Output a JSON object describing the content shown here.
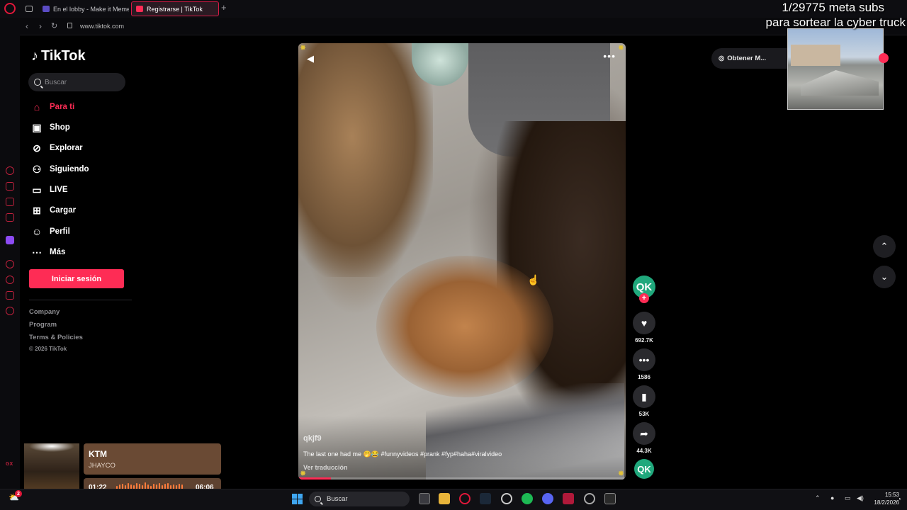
{
  "browser": {
    "tabs": [
      {
        "label": "",
        "icon": "workspaces-icon"
      },
      {
        "label": "En el lobby - Make it Meme",
        "icon": "mim-favicon"
      },
      {
        "label": "Registrarse | TikTok",
        "icon": "tiktok-favicon",
        "active": true
      }
    ],
    "url": "www.tiktok.com"
  },
  "overlay": {
    "line1": "1/29775 meta subs",
    "line2": "para sortear la cyber truck"
  },
  "tiktok": {
    "logo": "TikTok",
    "search_placeholder": "Buscar",
    "nav": [
      {
        "label": "Para ti",
        "icon": "home-icon",
        "active": true
      },
      {
        "label": "Shop",
        "icon": "shopping-bag-icon"
      },
      {
        "label": "Explorar",
        "icon": "compass-icon"
      },
      {
        "label": "Siguiendo",
        "icon": "following-icon"
      },
      {
        "label": "LIVE",
        "icon": "live-tv-icon"
      },
      {
        "label": "Cargar",
        "icon": "upload-icon"
      },
      {
        "label": "Perfil",
        "icon": "profile-icon"
      },
      {
        "label": "Más",
        "icon": "more-dots-icon"
      }
    ],
    "login_button": "Iniciar sesión",
    "footer": {
      "links": [
        "Company",
        "Program",
        "Terms & Policies"
      ],
      "copyright": "© 2026 TikTok"
    },
    "get_app": "Obtener M...",
    "video": {
      "author": "qkjf9",
      "caption": "The last one had me 🤭😂 #funnyvideos #prank #fyp#haha#viralvideo",
      "translate": "Ver traducción",
      "progress": 0.1
    },
    "actions": {
      "avatar_initials": "QK",
      "likes": "692.7K",
      "comments": "1586",
      "saves": "53K",
      "shares": "44.3K"
    }
  },
  "music": {
    "title": "KTM",
    "artist": "JHAYCO",
    "elapsed": "01:22",
    "total": "06:06",
    "progress": 0.22
  },
  "taskbar": {
    "search_placeholder": "Buscar",
    "time": "15:53",
    "date": "18/2/2026",
    "weather_badge": "2"
  },
  "colors": {
    "accent": "#fe2c55",
    "opera": "#e0183a",
    "avatar": "#20a87c"
  }
}
